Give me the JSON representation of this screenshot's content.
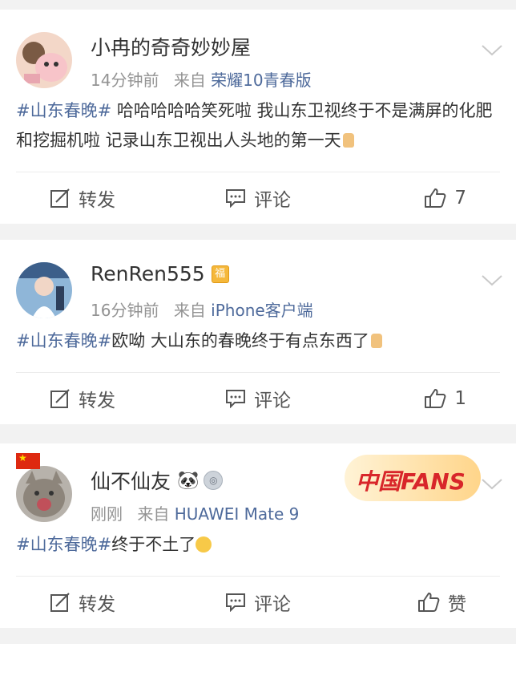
{
  "posts": [
    {
      "username": "小冉的奇奇妙妙屋",
      "time": "14分钟前",
      "from_label": "来自",
      "source": "荣耀10青春版",
      "hashtag": "#山东春晚#",
      "body": " 哈哈哈哈哈笑死啦 我山东卫视终于不是满屏的化肥和挖掘机啦 记录山东卫视出人头地的第一天",
      "repost_label": "转发",
      "comment_label": "评论",
      "like_label": "7"
    },
    {
      "username": "RenRen555",
      "badge": "福",
      "time": "16分钟前",
      "from_label": "来自",
      "source": "iPhone客户端",
      "hashtag": "#山东春晚#",
      "body": "欧呦  大山东的春晚终于有点东西了",
      "repost_label": "转发",
      "comment_label": "评论",
      "like_label": "1"
    },
    {
      "username": "仙不仙友",
      "time": "刚刚",
      "from_label": "来自",
      "source": "HUAWEI Mate 9",
      "hashtag": "#山东春晚#",
      "body": "终于不土了",
      "fans_banner": "中国FANS",
      "repost_label": "转发",
      "comment_label": "评论",
      "like_label": "赞"
    }
  ],
  "colors": {
    "link": "#4e6a9b",
    "text": "#333333",
    "meta": "#939393",
    "bg": "#f2f2f2"
  }
}
